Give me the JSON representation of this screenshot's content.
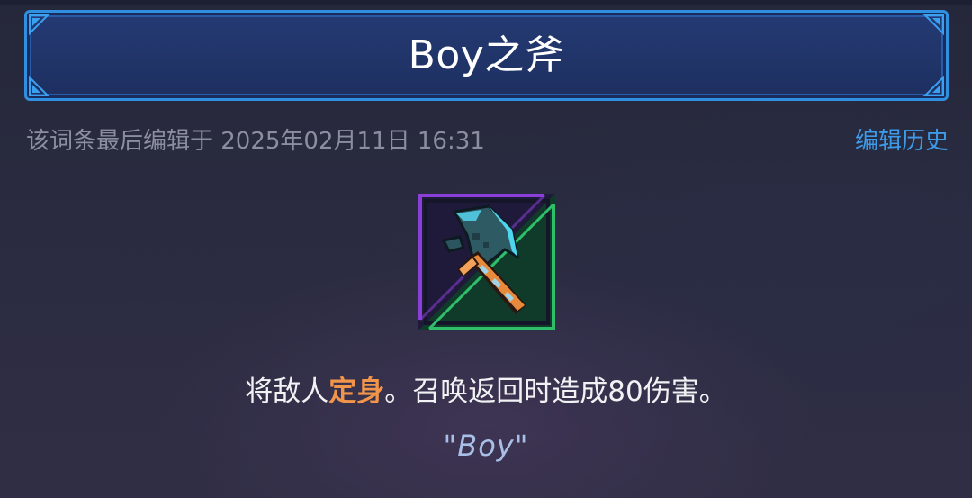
{
  "header": {
    "title": "Boy之斧"
  },
  "meta": {
    "last_edited": "该词条最后编辑于 2025年02月11日 16:31",
    "history_link": "编辑历史"
  },
  "item": {
    "icon": "axe-icon",
    "frame_colors": [
      "#8a3fd8",
      "#2fbf6a"
    ]
  },
  "description": {
    "part1": "将敌人",
    "keyword": "定身",
    "part2": "。召唤返回时造成80伤害。",
    "quote": "\"Boy\""
  },
  "colors": {
    "accent": "#3d9ae8",
    "keyword": "#f0954a",
    "banner_border": "#2f8fe0"
  }
}
